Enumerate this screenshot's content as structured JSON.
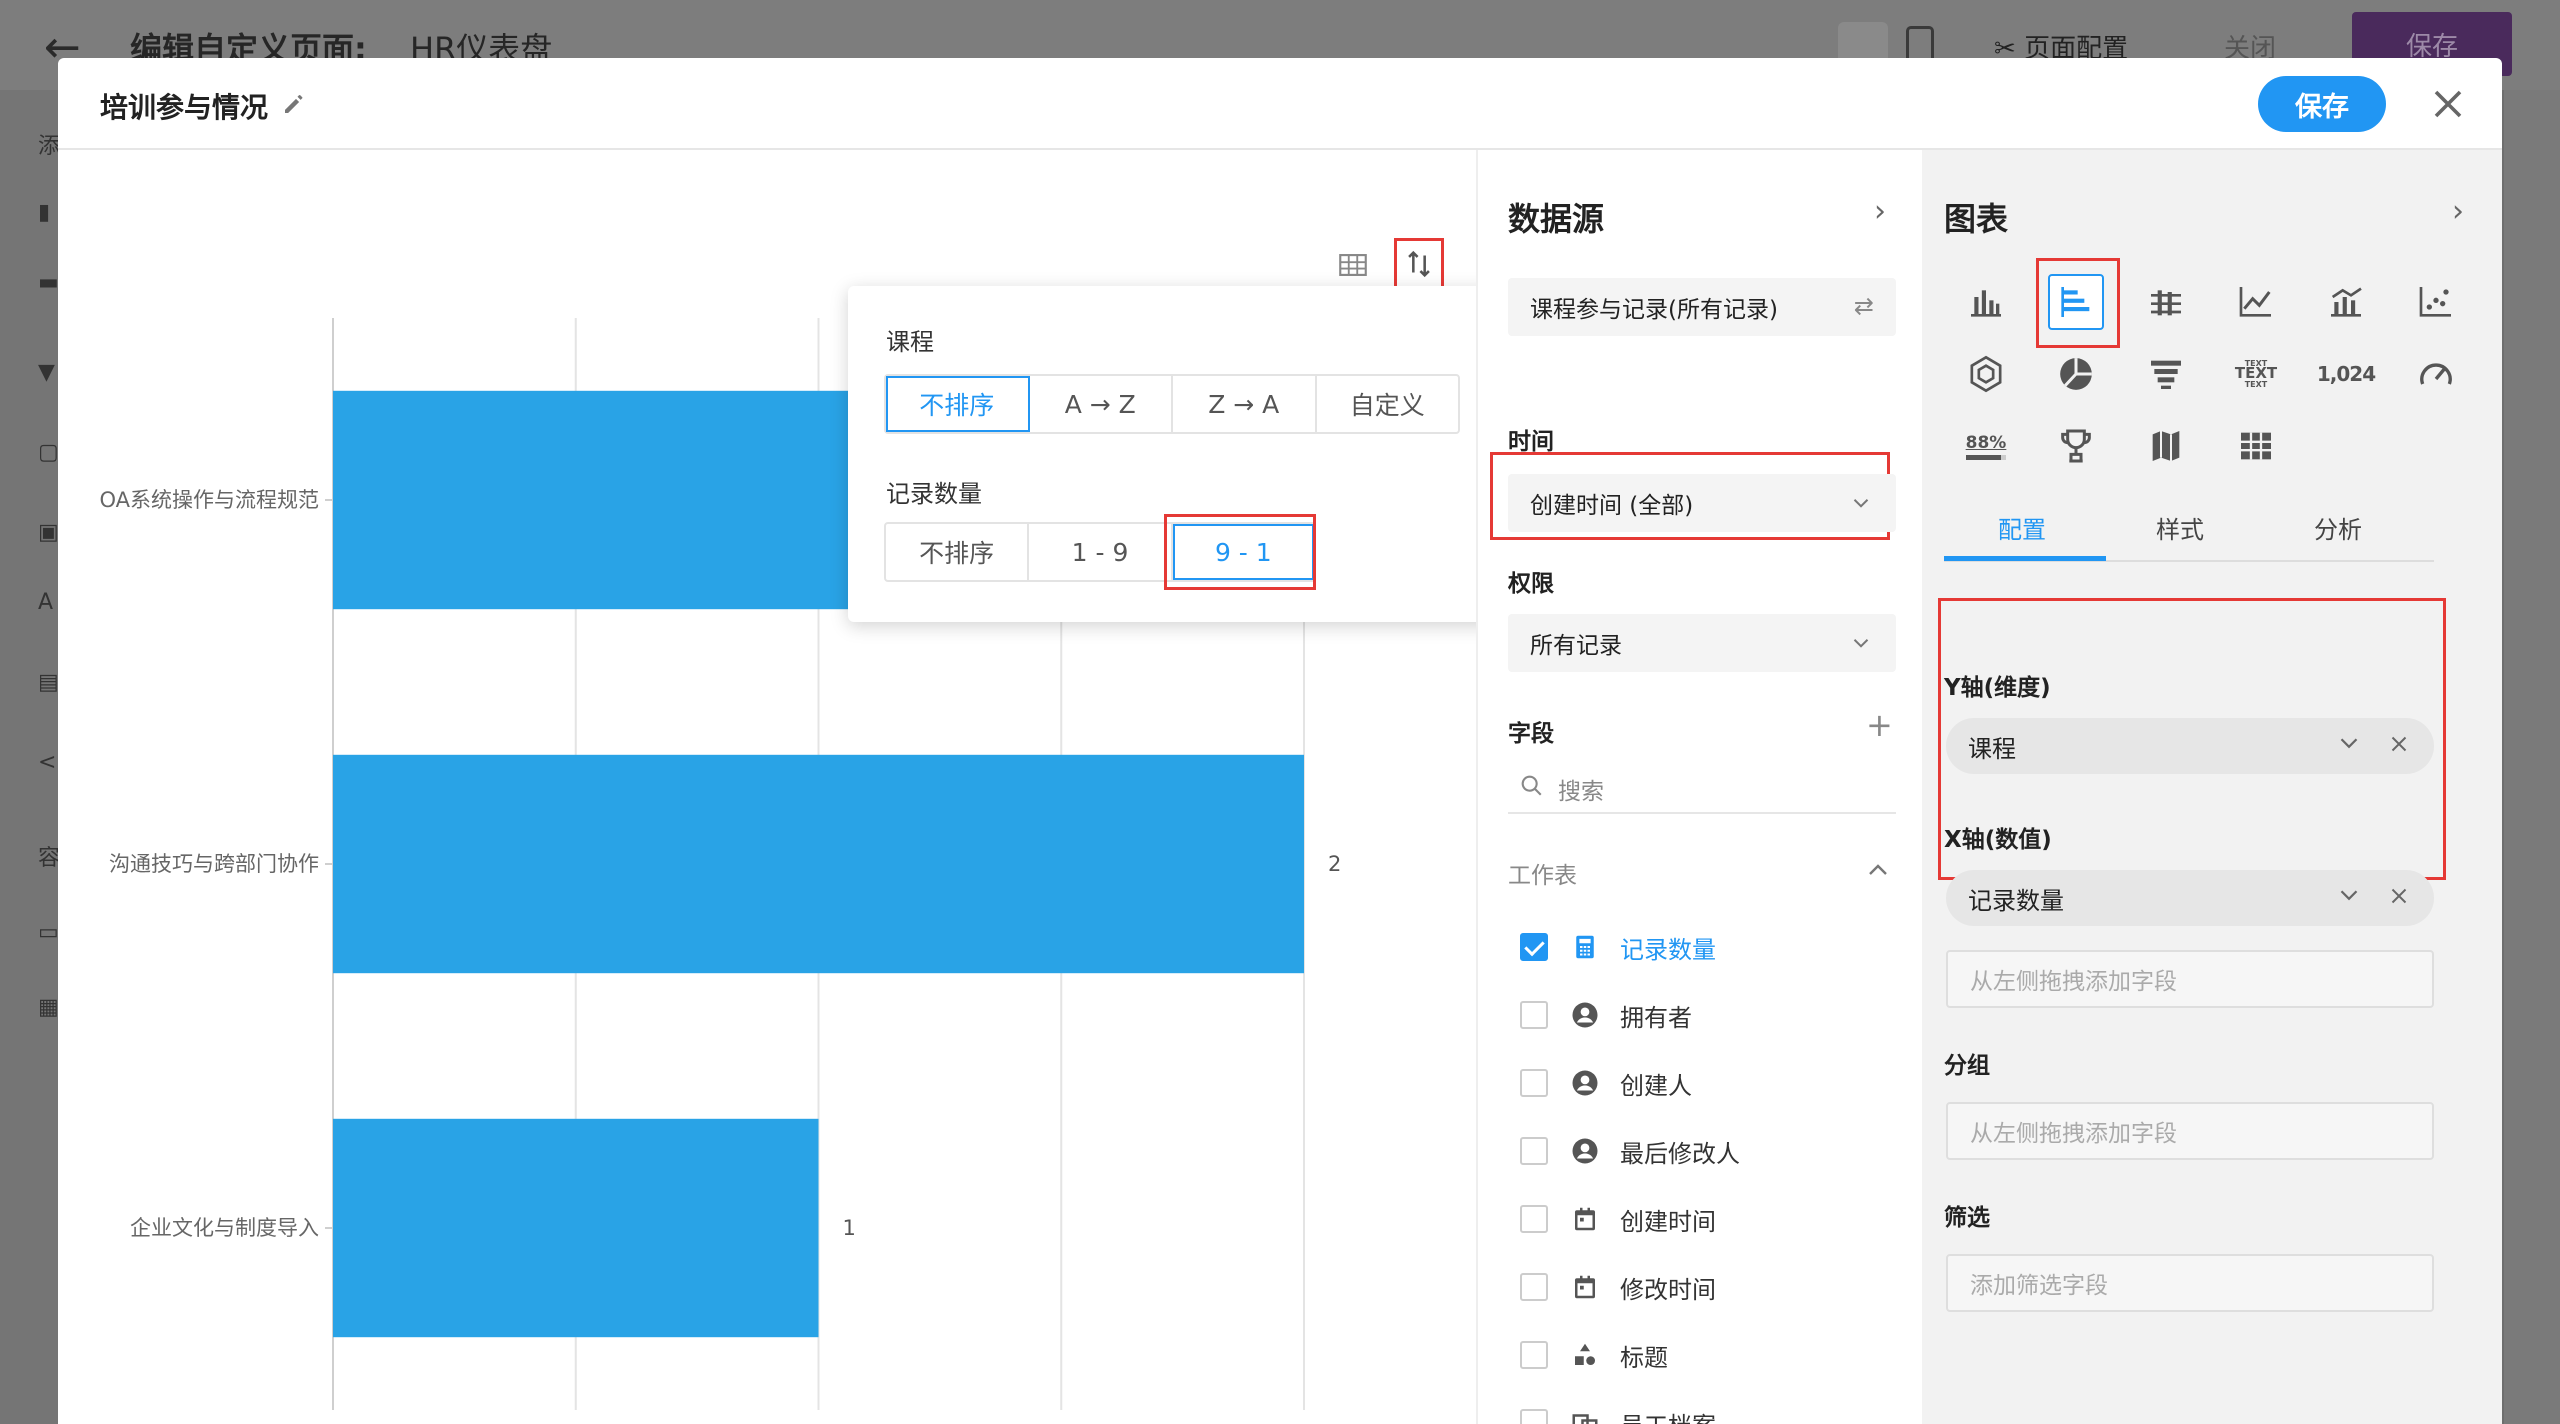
{
  "background": {
    "page_title": "编辑自定义页面:",
    "app_name": "HR仪表盘",
    "page_config_label": "页面配置",
    "close_label": "关闭",
    "save_label": "保存",
    "side_chars": [
      "添",
      "",
      "",
      "",
      "",
      "",
      "A",
      "",
      "<",
      "容",
      "",
      ""
    ]
  },
  "modal": {
    "title": "培训参与情况",
    "save_label": "保存"
  },
  "chart_data": {
    "type": "bar",
    "orientation": "horizontal",
    "categories": [
      "OA系统操作与流程规范",
      "沟通技巧与跨部门协作",
      "企业文化与制度导入"
    ],
    "values": [
      2,
      2,
      1
    ],
    "value_labels": [
      "",
      "2",
      "1"
    ],
    "xlim": [
      0,
      2
    ],
    "xticks": [
      "0",
      "0.5",
      "1",
      "1.5",
      "2"
    ],
    "bar_color": "#29a3e6",
    "grid": true
  },
  "sort_popover": {
    "course_label": "课程",
    "course_options": [
      "不排序",
      "A → Z",
      "Z → A",
      "自定义"
    ],
    "course_selected": 0,
    "count_label": "记录数量",
    "count_options": [
      "不排序",
      "1 - 9",
      "9 - 1"
    ],
    "count_selected": 2
  },
  "datasource": {
    "title": "数据源",
    "source": "课程参与记录(所有记录)",
    "time_label": "时间",
    "time_value": "创建时间 (全部)",
    "permission_label": "权限",
    "permission_value": "所有记录",
    "fields_label": "字段",
    "search_placeholder": "搜索",
    "worksheet_label": "工作表",
    "fields": [
      {
        "name": "记录数量",
        "icon": "calculator-icon",
        "checked": true
      },
      {
        "name": "拥有者",
        "icon": "user-icon",
        "checked": false
      },
      {
        "name": "创建人",
        "icon": "user-icon",
        "checked": false
      },
      {
        "name": "最后修改人",
        "icon": "user-icon",
        "checked": false
      },
      {
        "name": "创建时间",
        "icon": "calendar-icon",
        "checked": false
      },
      {
        "name": "修改时间",
        "icon": "calendar-icon",
        "checked": false
      },
      {
        "name": "标题",
        "icon": "shapes-icon",
        "checked": false
      },
      {
        "name": "员工档案",
        "icon": "link-icon",
        "checked": false
      }
    ]
  },
  "config": {
    "title": "图表",
    "chart_types": [
      "bar-chart-icon",
      "horizontal-bar-chart-icon",
      "stacked-bar-chart-icon",
      "line-chart-icon",
      "combo-chart-icon",
      "scatter-chart-icon",
      "radar-chart-icon",
      "pie-chart-icon",
      "funnel-chart-icon",
      "wordcloud-icon",
      "number-chart-icon",
      "gauge-chart-icon",
      "progress-chart-icon",
      "ranking-chart-icon",
      "map-chart-icon",
      "pivot-table-icon"
    ],
    "number_sample": "1,024",
    "progress_sample": "88%",
    "text_sample": "TEXT",
    "tabs": [
      "配置",
      "样式",
      "分析"
    ],
    "y_axis_label": "Y轴(维度)",
    "y_axis_value": "课程",
    "x_axis_label": "X轴(数值)",
    "x_axis_value": "记录数量",
    "drop_placeholder": "从左侧拖拽添加字段",
    "group_label": "分组",
    "filter_label": "筛选",
    "filter_placeholder": "添加筛选字段"
  }
}
